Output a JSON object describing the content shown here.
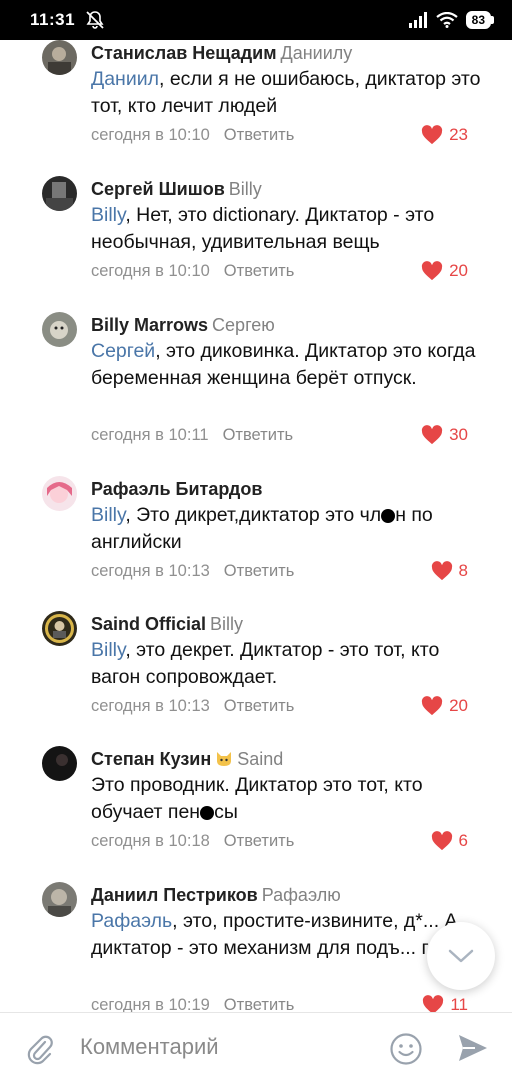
{
  "status_bar": {
    "time": "11:31",
    "battery": "83"
  },
  "comments": [
    {
      "author": "Станислав Нещадим",
      "reply_to": "Даниилу",
      "mention": "Даниил",
      "text": ", если я не ошибаюсь, диктатор это тот, кто лечит людей",
      "time": "сегодня в 10:10",
      "likes": "23"
    },
    {
      "author": "Сергей Шишов",
      "reply_to": "Billy",
      "mention": "Billy",
      "text": ", Нет, это dictionary. Диктатор - это необычная, удивительная вещь",
      "time": "сегодня в 10:10",
      "likes": "20"
    },
    {
      "author": "Billy Marrows",
      "reply_to": "Сергею",
      "mention": "Сергей",
      "text": ", это диковинка. Диктатор это когда беременная женщина берёт отпуск.",
      "time": "сегодня в 10:11",
      "likes": "30"
    },
    {
      "author": "Рафаэль Битардов",
      "reply_to": "",
      "mention": "Billy",
      "text_a": ", Это дикрет,диктатор это чл",
      "text_b": "н по английски",
      "time": "сегодня в 10:13",
      "likes": "8"
    },
    {
      "author": "Saind Official",
      "reply_to": "Billy",
      "mention": "Billy",
      "text": ", это декрет. Диктатор - это тот, кто вагон сопровождает.",
      "time": "сегодня в 10:13",
      "likes": "20"
    },
    {
      "author": "Степан Кузин",
      "reply_to": "Saind",
      "mention": "",
      "text_a": "Это проводник. Диктатор это тот, кто обучает пен",
      "text_b": "сы",
      "time": "сегодня в 10:18",
      "likes": "6"
    },
    {
      "author": "Даниил Пестриков",
      "reply_to": "Рафаэлю",
      "mention": "Рафаэль",
      "text": ", это, простите-извините, д*... А диктатор - это механизм для подъ... грузов",
      "time": "сегодня в 10:19",
      "likes": "11"
    }
  ],
  "reply_label": "Ответить",
  "input": {
    "placeholder": "Комментарий"
  },
  "colors": {
    "accent": "#4a76a8",
    "like": "#e64646",
    "meta": "#909090"
  },
  "icons": [
    "bell-off-icon",
    "signal-icon",
    "wifi-icon",
    "battery-icon",
    "heart-icon",
    "chevron-down-icon",
    "paperclip-icon",
    "smile-icon",
    "send-icon"
  ]
}
